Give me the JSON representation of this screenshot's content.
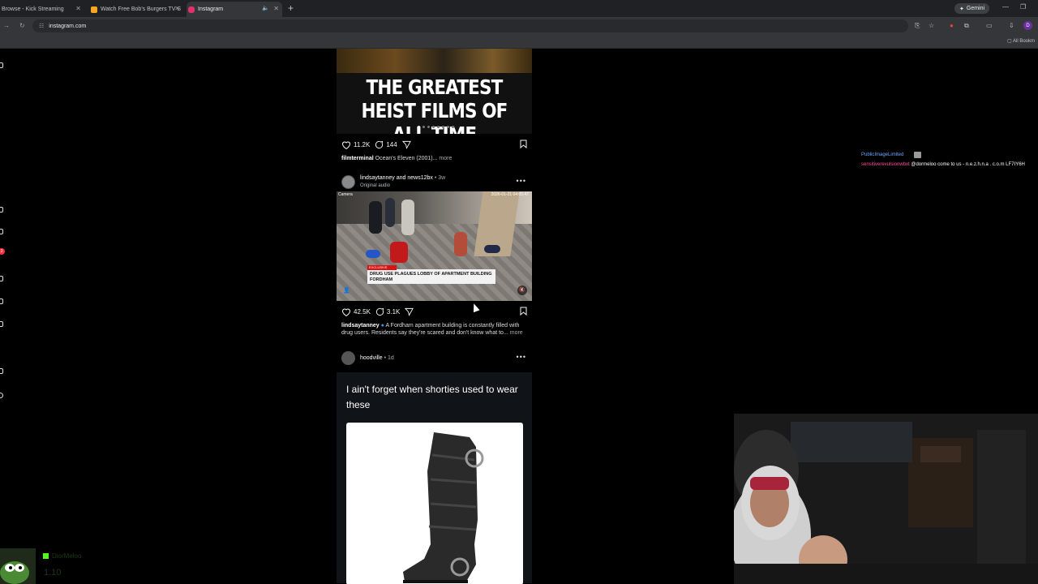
{
  "browser": {
    "tabs": [
      {
        "title": "Browse - Kick Streaming",
        "favicon_color": "#53fc18",
        "active": false
      },
      {
        "title": "Watch Free Bob's Burgers TV S",
        "favicon_color": "#f5a623",
        "active": false
      },
      {
        "title": "Instagram",
        "favicon_color": "#e1306c",
        "active": true
      }
    ],
    "new_tab_label": "+",
    "gemini_label": "Gemini",
    "url": "instagram.com",
    "bookmarks_label": "All Bookm"
  },
  "feed": {
    "post1": {
      "image_headline": "THE GREATEST HEIST FILMS OF ALL TIME",
      "likes": "11.2K",
      "comments": "144",
      "caption_user": "filmterminal",
      "caption_text": "Ocean's Eleven (2001)...",
      "more": "more"
    },
    "post2": {
      "users": "lindsaytanney and news12bx",
      "time": "• 3w",
      "audio": "Original audio",
      "video_timestamp": "2026-01-21 04:05:47",
      "banner_tag": "EXCLUSIVE",
      "banner_text": "DRUG USE PLAGUES LOBBY OF APARTMENT BUILDING FORDHAM",
      "likes": "42.5K",
      "comments": "3.1K",
      "caption_user": "lindsaytanney",
      "caption_text": "A Fordham apartment building is constantly filled with drug users. Residents say they're scared and don't know what to...",
      "more": "more"
    },
    "post3": {
      "user": "hoodville",
      "time": "• 1d",
      "tweet_text": "I ain't forget when shorties used to wear these"
    }
  },
  "chat": {
    "line1_user": "PublicImageLimited",
    "line2_user": "sensitiverevulsionwbxt",
    "line2_text": "@dormeloo come to us - n.e.z.h.n.a . c.o.m LF7IY6H"
  },
  "stream": {
    "bottom_name": "DiorMeloo",
    "bottom_count": "1.10"
  },
  "colors": {
    "page_bg": "#000000",
    "chrome_bg": "#35363a",
    "tabbar_bg": "#202124",
    "link_blue": "#6ea8ff",
    "chat_pink": "#ff4f9a"
  }
}
